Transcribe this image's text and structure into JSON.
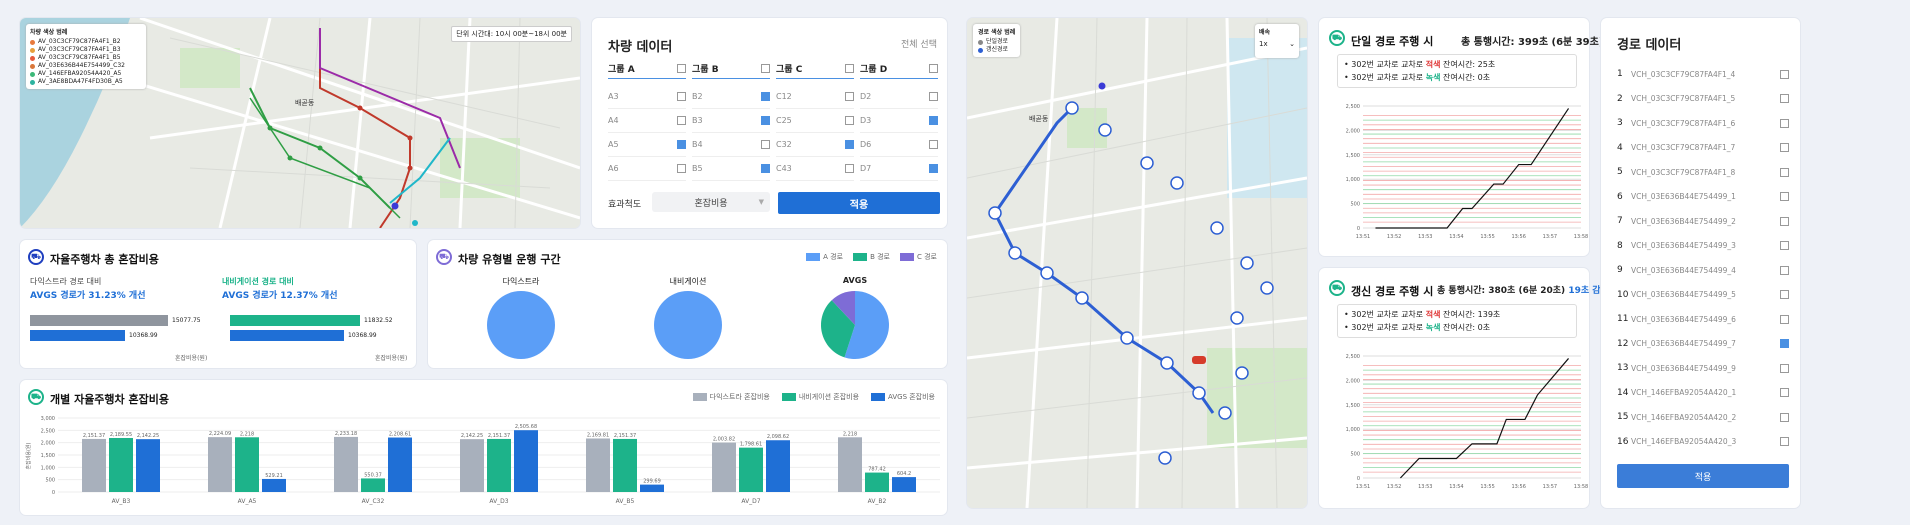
{
  "left": {
    "map_legend": {
      "title": "차량 색상 범례",
      "items": [
        {
          "label": "AV_03C3CF79C87FA4F1_B2",
          "color": "#e87a3c"
        },
        {
          "label": "AV_03C3CF79C87FA4F1_B3",
          "color": "#e8a03c"
        },
        {
          "label": "AV_03C3CF79C87FA4F1_B5",
          "color": "#e85b3c"
        },
        {
          "label": "AV_03E636B44E754499_C32",
          "color": "#d9773b"
        },
        {
          "label": "AV_146EFBA92054A420_A5",
          "color": "#3cb878"
        },
        {
          "label": "AV_3AE8BDA47F4FD30B_A5",
          "color": "#2db3a0"
        }
      ]
    },
    "map_time": "단위 시간대: 10시 00분~18시 00분",
    "map_place": "배곧동",
    "vehicle_data": {
      "title": "차량 데이터",
      "select_all": "전체 선택",
      "groups": [
        {
          "name": "그룹 A",
          "items": [
            {
              "id": "A3",
              "checked": false
            },
            {
              "id": "A4",
              "checked": false
            },
            {
              "id": "A5",
              "checked": true
            },
            {
              "id": "A6",
              "checked": false
            }
          ]
        },
        {
          "name": "그룹 B",
          "items": [
            {
              "id": "B2",
              "checked": true
            },
            {
              "id": "B3",
              "checked": true
            },
            {
              "id": "B4",
              "checked": false
            },
            {
              "id": "B5",
              "checked": true
            }
          ]
        },
        {
          "name": "그룹 C",
          "items": [
            {
              "id": "C12",
              "checked": false
            },
            {
              "id": "C25",
              "checked": false
            },
            {
              "id": "C32",
              "checked": true
            },
            {
              "id": "C43",
              "checked": false
            }
          ]
        },
        {
          "name": "그룹 D",
          "items": [
            {
              "id": "D2",
              "checked": false
            },
            {
              "id": "D3",
              "checked": true
            },
            {
              "id": "D6",
              "checked": false
            },
            {
              "id": "D7",
              "checked": true
            }
          ]
        }
      ],
      "metric_label": "효과척도",
      "metric_value": "혼잡비용",
      "apply": "적용"
    },
    "total_cost": {
      "title": "자율주행차 총 혼잡비용",
      "a_label": "다익스트라 경로 대비",
      "a_text": "AVGS 경로가 31.23% 개선",
      "b_label": "내비게이션 경로 대비",
      "b_text": "AVGS 경로가 12.37% 개선",
      "a_vals": [
        "15077.75",
        "10368.99"
      ],
      "b_vals": [
        "11832.52",
        "10368.99"
      ],
      "axis": "혼잡비용(원)"
    },
    "segments": {
      "title": "차량 유형별 운행 구간",
      "legend": [
        {
          "label": "A 경로",
          "color": "#5b9ef7"
        },
        {
          "label": "B 경로",
          "color": "#1db38a"
        },
        {
          "label": "C 경로",
          "color": "#7e6cd6"
        }
      ],
      "pies": [
        "다익스트라",
        "내비게이션",
        "AVGS"
      ]
    },
    "indiv": {
      "title": "개별 자율주행차 혼잡비용",
      "legend": [
        {
          "label": "다익스트라 혼잡비용",
          "color": "#a8b0bc"
        },
        {
          "label": "내비게이션 혼잡비용",
          "color": "#1db38a"
        },
        {
          "label": "AVGS 혼잡비용",
          "color": "#1f6fd6"
        }
      ],
      "ylabel": "혼잡비용(원)"
    }
  },
  "right": {
    "map_legend": {
      "title": "경로 색상 범례",
      "items": [
        {
          "label": "단일경로",
          "color": "#888"
        },
        {
          "label": "갱신경로",
          "color": "#2d5fd3"
        }
      ]
    },
    "speed": {
      "label": "배속",
      "value": "1x"
    },
    "place": "배곧동",
    "single": {
      "title": "단일 경로 주행 시",
      "total": "총 통행시간:  399초 (6분 39초)",
      "line1a": "302번 교차로",
      "line1b": "적색",
      "line1c": "잔여시간: 25초",
      "line2a": "302번 교차로",
      "line2b": "녹색",
      "line2c": "잔여시간: 0초"
    },
    "updated": {
      "title": "갱신 경로 주행 시",
      "total": "총 통행시간: 380초 (6분 20초)",
      "saving": "19초 감소",
      "line1a": "302번 교차로",
      "line1b": "적색",
      "line1c": "잔여시간: 139초",
      "line2a": "302번 교차로",
      "line2b": "녹색",
      "line2c": "잔여시간: 0초"
    },
    "route_data": {
      "title": "경로 데이터",
      "apply": "적용",
      "items": [
        {
          "n": "1",
          "id": "VCH_03C3CF79C87FA4F1_4",
          "checked": false
        },
        {
          "n": "2",
          "id": "VCH_03C3CF79C87FA4F1_5",
          "checked": false
        },
        {
          "n": "3",
          "id": "VCH_03C3CF79C87FA4F1_6",
          "checked": false
        },
        {
          "n": "4",
          "id": "VCH_03C3CF79C87FA4F1_7",
          "checked": false
        },
        {
          "n": "5",
          "id": "VCH_03C3CF79C87FA4F1_8",
          "checked": false
        },
        {
          "n": "6",
          "id": "VCH_03E636B44E754499_1",
          "checked": false
        },
        {
          "n": "7",
          "id": "VCH_03E636B44E754499_2",
          "checked": false
        },
        {
          "n": "8",
          "id": "VCH_03E636B44E754499_3",
          "checked": false
        },
        {
          "n": "9",
          "id": "VCH_03E636B44E754499_4",
          "checked": false
        },
        {
          "n": "10",
          "id": "VCH_03E636B44E754499_5",
          "checked": false
        },
        {
          "n": "11",
          "id": "VCH_03E636B44E754499_6",
          "checked": false
        },
        {
          "n": "12",
          "id": "VCH_03E636B44E754499_7",
          "checked": true
        },
        {
          "n": "13",
          "id": "VCH_03E636B44E754499_9",
          "checked": false
        },
        {
          "n": "14",
          "id": "VCH_146EFBA92054A420_1",
          "checked": false
        },
        {
          "n": "15",
          "id": "VCH_146EFBA92054A420_2",
          "checked": false
        },
        {
          "n": "16",
          "id": "VCH_146EFBA92054A420_3",
          "checked": false
        }
      ]
    }
  },
  "chart_data": [
    {
      "type": "bar",
      "title": "자율주행차 총 혼잡비용",
      "series": [
        {
          "name": "다익스트라 경로 대비",
          "values": [
            15077.75,
            10368.99
          ]
        },
        {
          "name": "내비게이션 경로 대비",
          "values": [
            11832.52,
            10368.99
          ]
        }
      ]
    },
    {
      "type": "pie",
      "title": "차량 유형별 운행 구간",
      "pies": [
        {
          "name": "다익스트라",
          "values": [
            1,
            0,
            0
          ]
        },
        {
          "name": "내비게이션",
          "values": [
            1,
            0,
            0
          ]
        },
        {
          "name": "AVGS",
          "values": [
            0.55,
            0.33,
            0.12
          ]
        }
      ]
    },
    {
      "type": "bar",
      "title": "개별 자율주행차 혼잡비용",
      "ylabel": "혼잡비용(원)",
      "ylim": [
        0,
        3000
      ],
      "categories": [
        "AV_B3",
        "AV_A5",
        "AV_C32",
        "AV_D3",
        "AV_B5",
        "AV_D7",
        "AV_B2"
      ],
      "series": [
        {
          "name": "다익스트라 혼잡비용",
          "values": [
            2151.37,
            2224.09,
            2233.18,
            2142.25,
            2169.81,
            2003.82,
            2218
          ]
        },
        {
          "name": "내비게이션 혼잡비용",
          "values": [
            2189.55,
            2218,
            550.37,
            2151.37,
            2151.37,
            1798.61,
            787.42
          ]
        },
        {
          "name": "AVGS 혼잡비용",
          "values": [
            2142.25,
            529.21,
            2208.61,
            2505.68,
            299.69,
            2098.62,
            604.2
          ]
        }
      ],
      "labels": [
        [
          "2,151.37",
          "2,189.55",
          "2,142.25"
        ],
        [
          "2,224.09",
          "2,218",
          "529.21"
        ],
        [
          "2,233.18",
          "550.37",
          "2,208.61"
        ],
        [
          "2,142.25",
          "2,151.37",
          "2,505.68"
        ],
        [
          "2,169.81",
          "2,151.37",
          "299.69"
        ],
        [
          "2,003.82",
          "1,798.61",
          "2,098.62"
        ],
        [
          "2,218",
          "787.42",
          "604.2"
        ]
      ]
    },
    {
      "type": "line",
      "title": "단일 경로 주행 시",
      "x": [
        "13:51",
        "13:52",
        "13:53",
        "13:54",
        "13:55",
        "13:56",
        "13:57",
        "13:58"
      ],
      "ylim": [
        0,
        2500
      ],
      "yticks": [
        "0",
        "500",
        "1,000",
        "1,500",
        "2,000",
        "2,500"
      ]
    },
    {
      "type": "line",
      "title": "갱신 경로 주행 시",
      "x": [
        "13:51",
        "13:52",
        "13:53",
        "13:54",
        "13:55",
        "13:56",
        "13:57",
        "13:58"
      ],
      "ylim": [
        0,
        2500
      ],
      "yticks": [
        "0",
        "500",
        "1,000",
        "1,500",
        "2,000",
        "2,500"
      ]
    }
  ]
}
